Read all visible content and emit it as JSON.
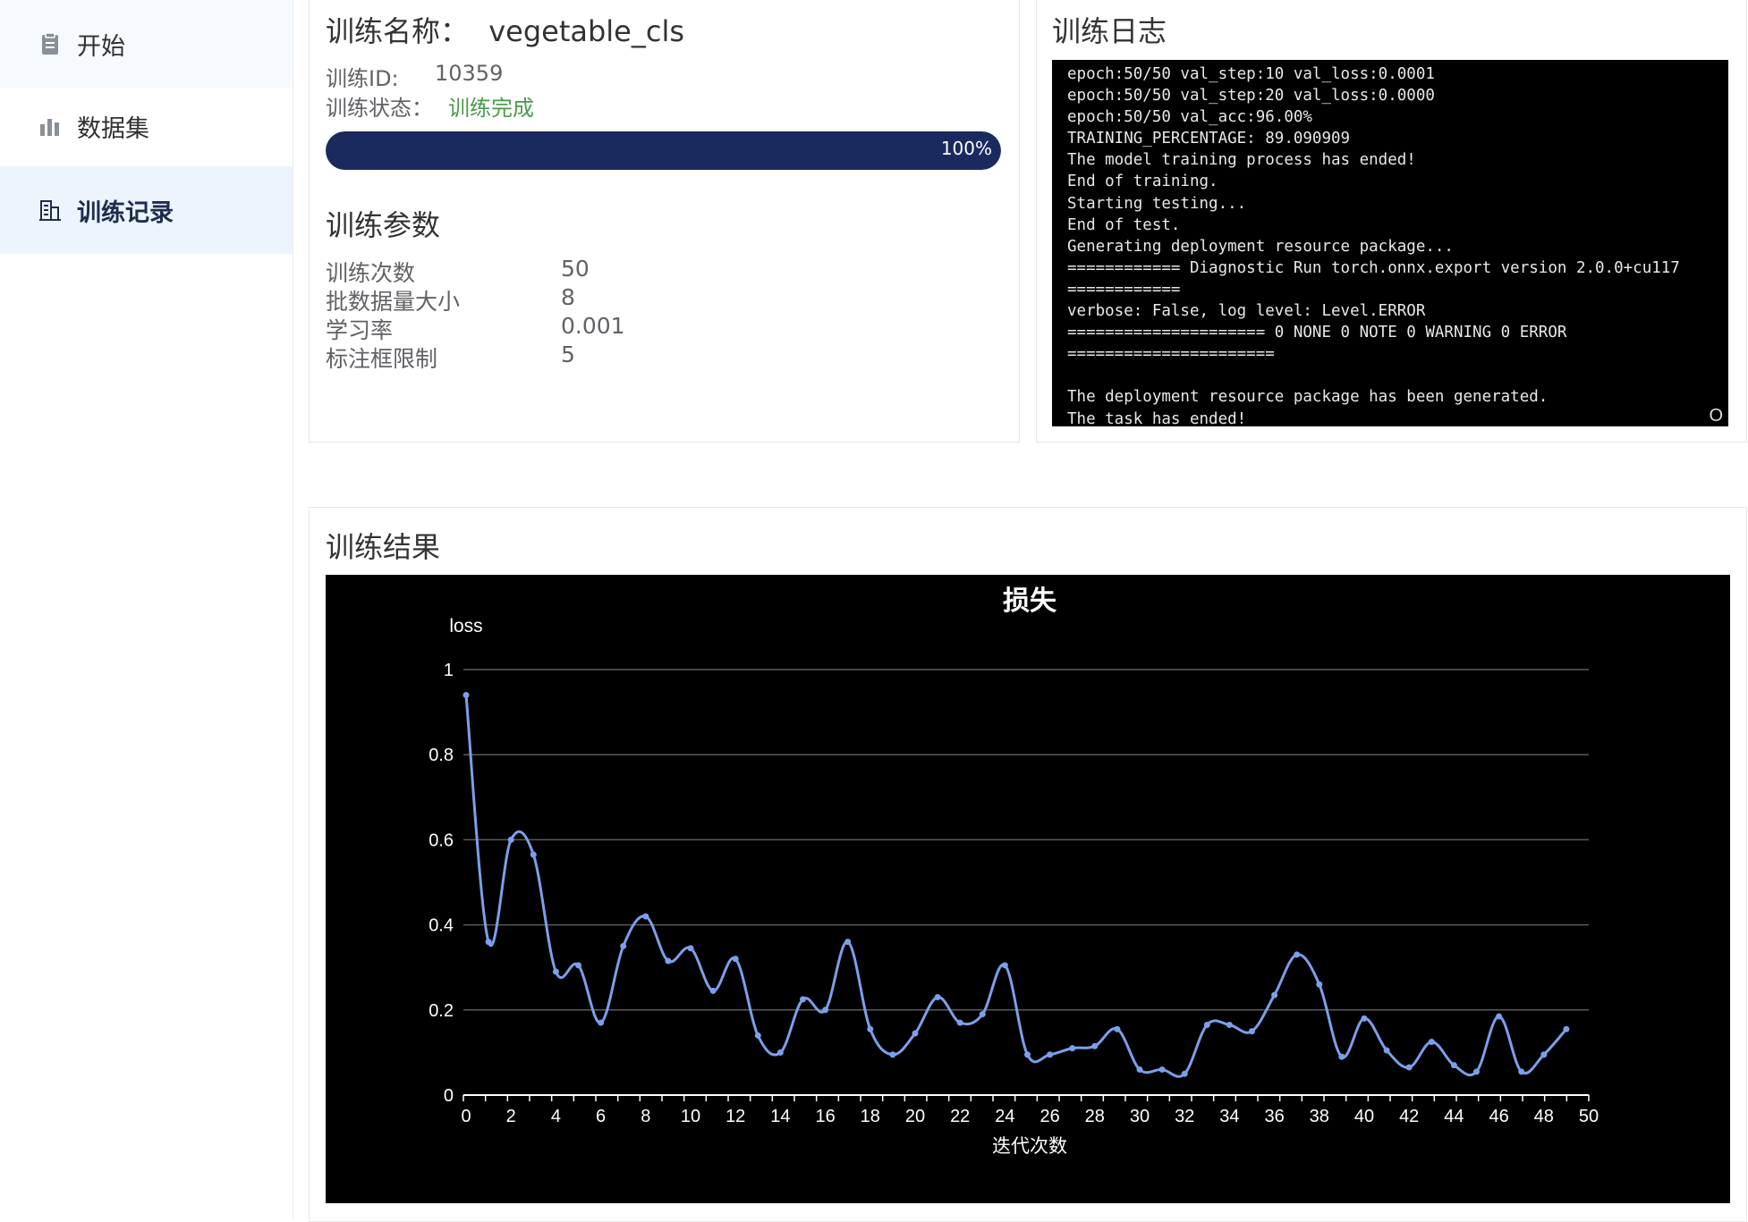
{
  "sidebar": {
    "items": [
      {
        "label": "开始",
        "icon": "clipboard-icon"
      },
      {
        "label": "数据集",
        "icon": "bar-chart-icon"
      },
      {
        "label": "训练记录",
        "icon": "records-icon",
        "active": true
      }
    ]
  },
  "training": {
    "name_label": "训练名称：",
    "name_value": "vegetable_cls",
    "id_label": "训练ID:",
    "id_value": "10359",
    "status_label": "训练状态：",
    "status_value": "训练完成",
    "status_color": "#4c9a4a",
    "progress": 1.0,
    "progress_text": "100%"
  },
  "params": {
    "title": "训练参数",
    "rows": [
      {
        "label": "训练次数",
        "value": "50"
      },
      {
        "label": "批数据量大小",
        "value": "8"
      },
      {
        "label": "学习率",
        "value": "0.001"
      },
      {
        "label": "标注框限制",
        "value": "5"
      }
    ]
  },
  "log": {
    "title": "训练日志",
    "lines": [
      "epoch:50/50 val_step:10 val_loss:0.0001",
      "epoch:50/50 val_step:20 val_loss:0.0000",
      "epoch:50/50 val_acc:96.00%",
      "TRAINING_PERCENTAGE: 89.090909",
      "The model training process has ended!",
      "End of training.",
      "Starting testing...",
      "End of test.",
      "Generating deployment resource package...",
      "============ Diagnostic Run torch.onnx.export version 2.0.0+cu117",
      "============",
      "verbose: False, log level: Level.ERROR",
      "===================== 0 NONE 0 NOTE 0 WARNING 0 ERROR",
      "======================",
      "",
      "The deployment resource package has been generated.",
      "The task has ended!"
    ],
    "corner_glyph": "O"
  },
  "results": {
    "title": "训练结果"
  },
  "chart_data": {
    "type": "line",
    "title": "损失",
    "xlabel": "迭代次数",
    "ylabel": "loss",
    "xlim": [
      0,
      50
    ],
    "ylim": [
      0,
      1
    ],
    "x_ticks": [
      "0",
      "2",
      "4",
      "6",
      "8",
      "10",
      "12",
      "14",
      "16",
      "18",
      "20",
      "22",
      "24",
      "26",
      "28",
      "30",
      "32",
      "34",
      "36",
      "38",
      "40",
      "42",
      "44",
      "46",
      "48",
      "50"
    ],
    "y_ticks": [
      "0",
      "0.2",
      "0.4",
      "0.6",
      "0.8",
      "1"
    ],
    "grid": true,
    "line_color": "#7b9fea",
    "series": [
      {
        "x": [
          0,
          1,
          2,
          3,
          4,
          5,
          6,
          7,
          8,
          9,
          10,
          11,
          12,
          13,
          14,
          15,
          16,
          17,
          18,
          19,
          20,
          21,
          22,
          23,
          24,
          25,
          26,
          27,
          28,
          29,
          30,
          31,
          32,
          33,
          34,
          35,
          36,
          37,
          38,
          39,
          40,
          41,
          42,
          43,
          44,
          45,
          46,
          47,
          48,
          49
        ],
        "values": [
          0.94,
          0.36,
          0.6,
          0.565,
          0.29,
          0.305,
          0.17,
          0.35,
          0.42,
          0.315,
          0.345,
          0.245,
          0.32,
          0.14,
          0.1,
          0.225,
          0.2,
          0.36,
          0.155,
          0.095,
          0.145,
          0.23,
          0.17,
          0.19,
          0.305,
          0.095,
          0.095,
          0.11,
          0.115,
          0.155,
          0.06,
          0.06,
          0.05,
          0.165,
          0.165,
          0.15,
          0.235,
          0.33,
          0.26,
          0.09,
          0.18,
          0.105,
          0.065,
          0.125,
          0.07,
          0.055,
          0.185,
          0.055,
          0.095,
          0.155
        ]
      }
    ]
  }
}
